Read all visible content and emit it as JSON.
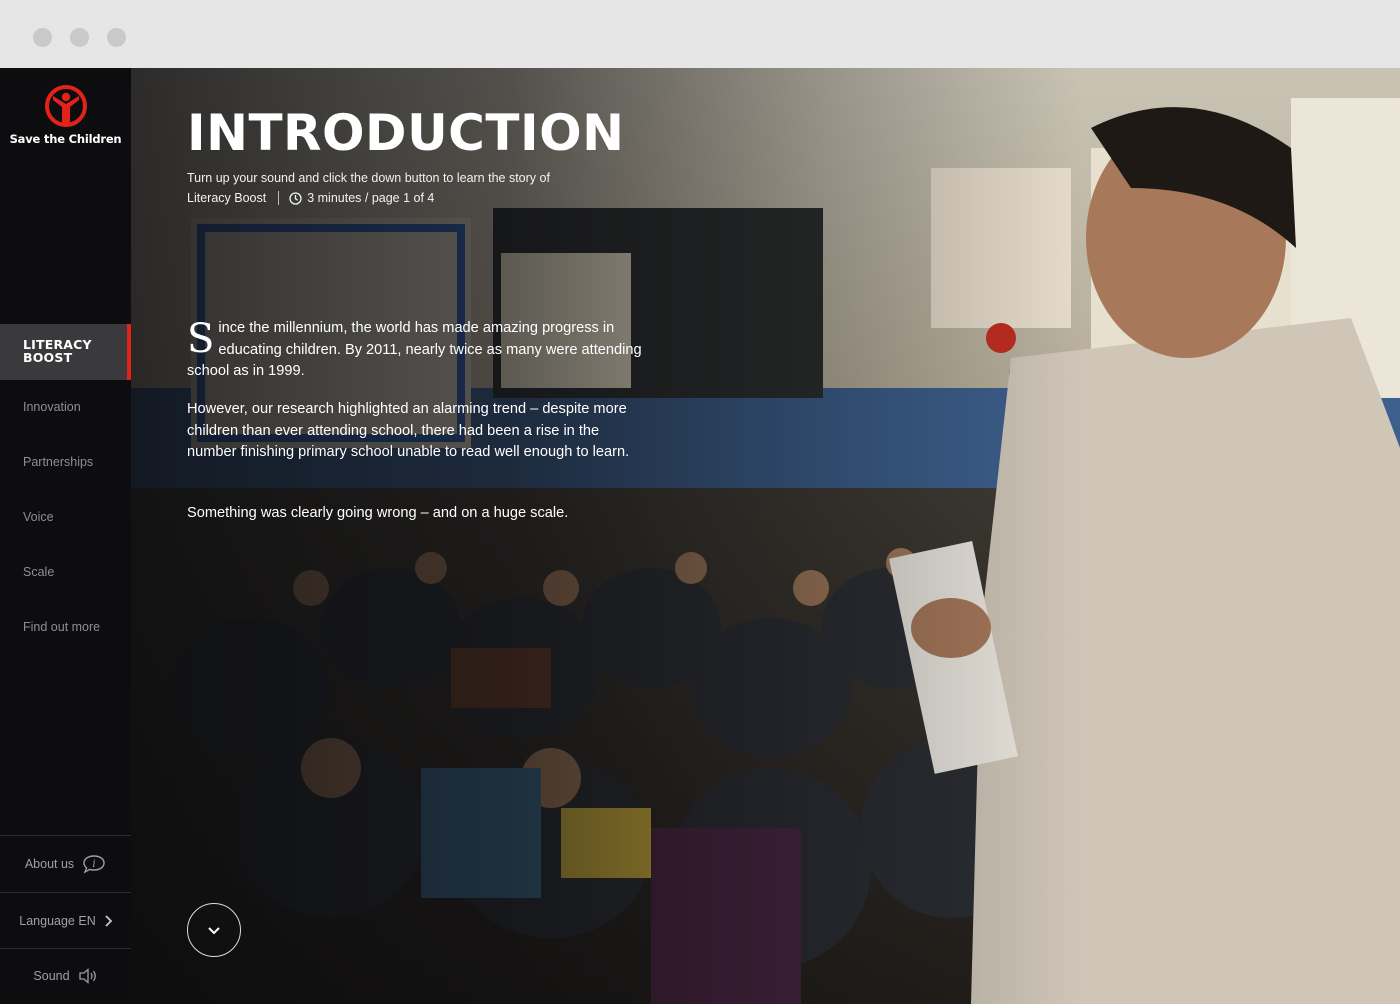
{
  "window": {
    "buttons": [
      "close",
      "minimize",
      "maximize"
    ]
  },
  "brand": {
    "name": "Save the Children",
    "logo_icon": "save-the-children-logo",
    "accent": "#e2231a"
  },
  "sidebar": {
    "active": {
      "line1": "LITERACY",
      "line2": "BOOST"
    },
    "items": [
      {
        "label": "Innovation"
      },
      {
        "label": "Partnerships"
      },
      {
        "label": "Voice"
      },
      {
        "label": "Scale"
      },
      {
        "label": "Find out more"
      }
    ],
    "about_label": "About us",
    "language_label": "Language EN",
    "sound_label": "Sound"
  },
  "hero": {
    "title": "INTRODUCTION",
    "subtitle": "Turn up your sound and click the down button to learn the story of",
    "meta_story": "Literacy Boost",
    "meta_time": "3 minutes / page 1 of 4",
    "para1_cap": "S",
    "para1_rest": "ince the millennium, the world has made amazing progress in educating children. By 2011, nearly twice as many were attending school as in 1999.",
    "para2": "However, our research highlighted an alarming trend – despite more children than ever attending school, there had been a rise in the number finishing primary school unable to read well enough to learn.",
    "para3": "Something was clearly going wrong – and on a huge scale."
  }
}
